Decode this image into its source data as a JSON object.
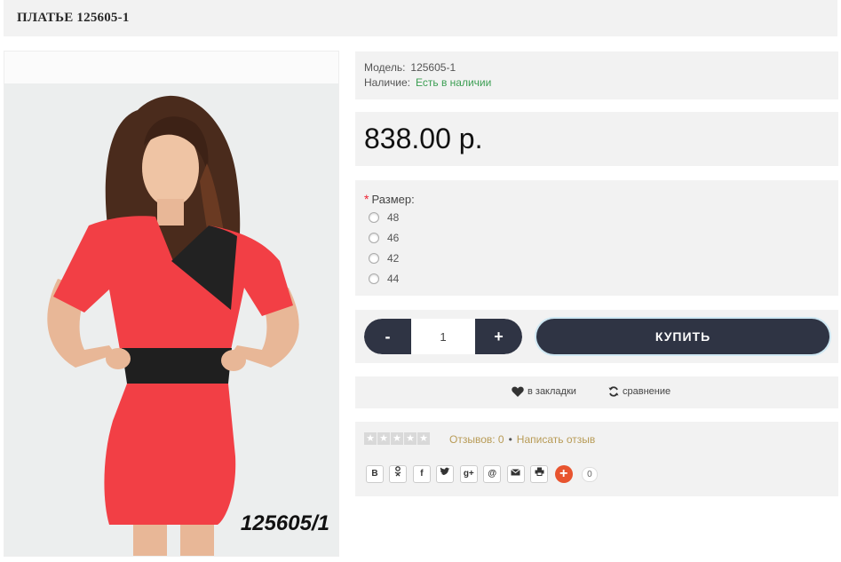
{
  "product": {
    "title": "ПЛАТЬЕ 125605-1",
    "photo_code": "125605/1",
    "model_label": "Модель:",
    "model_value": "125605-1",
    "stock_label": "Наличие:",
    "stock_value": "Есть в наличии",
    "stock_color": "#3b9e52",
    "price": "838.00 р."
  },
  "options": {
    "required_mark": "*",
    "size_label": "Размер:",
    "sizes": [
      "48",
      "46",
      "42",
      "44"
    ]
  },
  "cart": {
    "minus_label": "-",
    "plus_label": "+",
    "quantity": "1",
    "buy_label": "КУПИТЬ",
    "accent_color": "#2f3444"
  },
  "actions": {
    "wishlist_label": "в закладки",
    "wishlist_icon": "heart-icon",
    "compare_label": "сравнение",
    "compare_icon": "refresh-icon"
  },
  "reviews": {
    "rating": 0,
    "reviews_label": "Отзывов: 0",
    "separator": "•",
    "write_label": "Написать отзыв"
  },
  "share": {
    "buttons": [
      "B",
      "ok",
      "f",
      "twitter",
      "g+",
      "@",
      "mail",
      "print"
    ],
    "count": "0"
  }
}
